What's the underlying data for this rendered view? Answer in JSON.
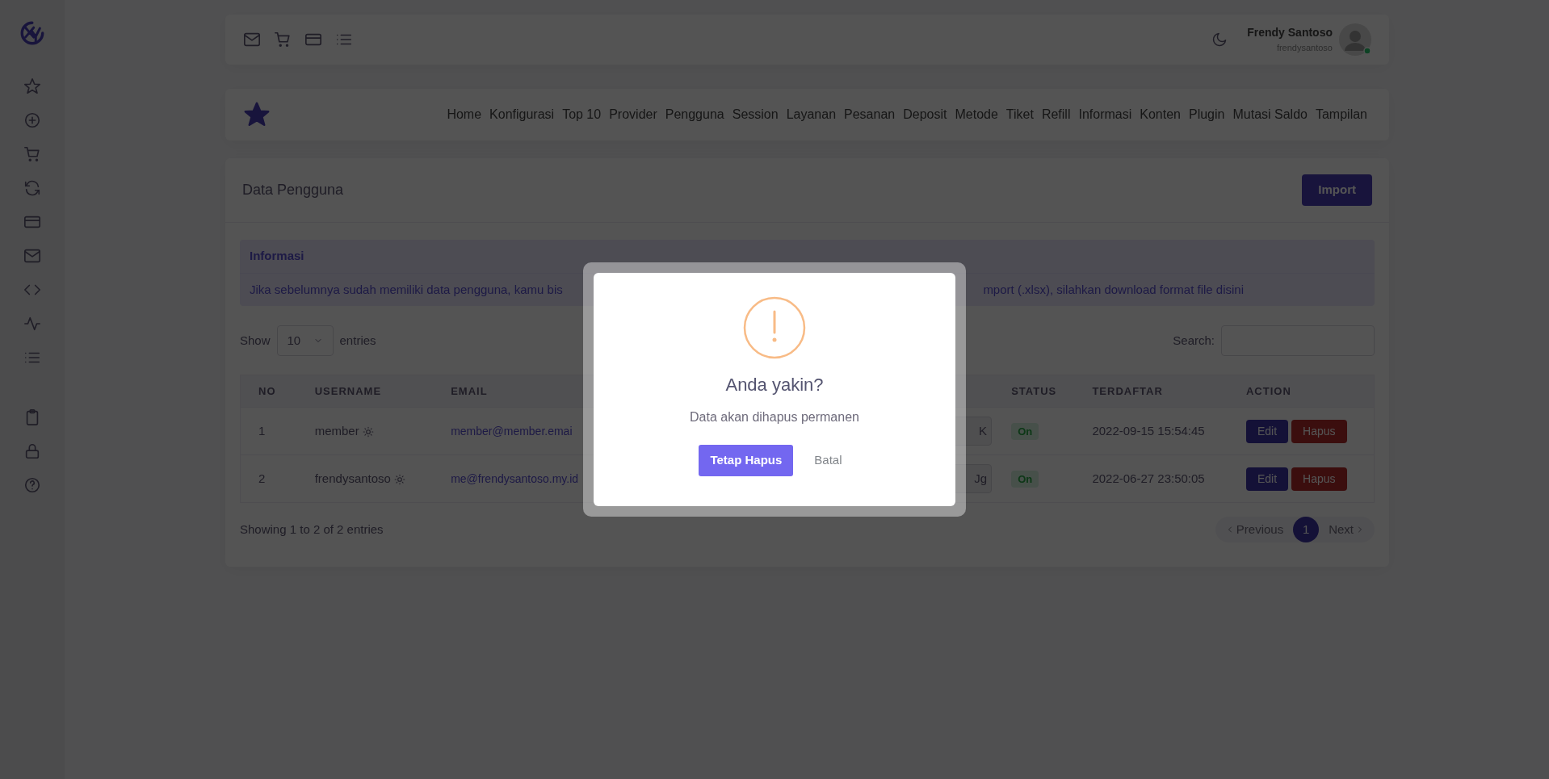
{
  "topbar": {
    "user_name": "Frendy Santoso",
    "username": "frendysantoso",
    "online": true
  },
  "nav": {
    "items": [
      "Home",
      "Konfigurasi",
      "Top 10",
      "Provider",
      "Pengguna",
      "Session",
      "Layanan",
      "Pesanan",
      "Deposit",
      "Metode",
      "Tiket",
      "Refill",
      "Informasi",
      "Konten",
      "Plugin",
      "Mutasi Saldo",
      "Tampilan"
    ]
  },
  "card": {
    "title": "Data Pengguna",
    "import_button": "Import"
  },
  "alert": {
    "title": "Informasi",
    "text_left": "Jika sebelumnya sudah memiliki data pengguna, kamu bis",
    "text_right": "mport (.xlsx), silahkan download format file disini"
  },
  "table_controls": {
    "show_label": "Show",
    "page_size": "10",
    "entries_label": "entries",
    "search_label": "Search:"
  },
  "table": {
    "columns_left": [
      "NO",
      "USERNAME",
      "EMAIL"
    ],
    "columns_right": [
      "STATUS",
      "TERDAFTAR",
      "ACTION"
    ],
    "rows": [
      {
        "no": "1",
        "username": "member",
        "email": "member@member.emai",
        "column_4": "K",
        "status": "On",
        "registered": "2022-09-15 15:54:45",
        "actions": [
          "Edit",
          "Hapus"
        ]
      },
      {
        "no": "2",
        "username": "frendysantoso",
        "email": "me@frendysantoso.my.id",
        "column_4": "Jg",
        "status": "On",
        "registered": "2022-06-27 23:50:05",
        "actions": [
          "Edit",
          "Hapus"
        ]
      }
    ]
  },
  "footer": {
    "info": "Showing 1 to 2 of 2 entries",
    "pagination": [
      {
        "label": "Previous",
        "kind": "prev",
        "disabled": true,
        "selected": false
      },
      {
        "label": "1",
        "kind": "page",
        "disabled": false,
        "selected": true
      },
      {
        "label": "Next",
        "kind": "next",
        "disabled": true,
        "selected": false
      }
    ]
  },
  "dialog": {
    "title": "Anda yakin?",
    "text": "Data akan dihapus permanen",
    "confirm": "Tetap Hapus",
    "cancel": "Batal"
  }
}
